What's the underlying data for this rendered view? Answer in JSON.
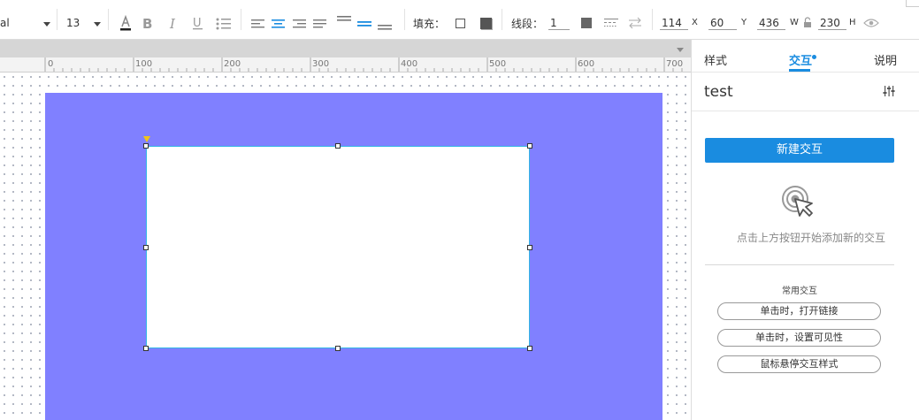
{
  "toolbar": {
    "font_family": "al",
    "font_size": "13",
    "fill_label": "填充：",
    "line_label": "线段：",
    "line_width": "1",
    "x_value": "114",
    "x_label": "X",
    "y_value": "60",
    "y_label": "Y",
    "w_value": "436",
    "w_label": "W",
    "h_value": "230",
    "h_label": "H"
  },
  "ruler": {
    "labels": [
      "0",
      "100",
      "200",
      "300",
      "400",
      "500",
      "600",
      "700"
    ]
  },
  "panel": {
    "tabs": [
      "样式",
      "交互",
      "说明"
    ],
    "active_tab": "交互",
    "widget_name": "test",
    "new_interaction_button": "新建交互",
    "empty_hint": "点击上方按钮开始添加新的交互",
    "common_title": "常用交互",
    "common_actions": [
      "单击时，打开链接",
      "单击时，设置可见性",
      "鼠标悬停交互样式"
    ]
  },
  "colors": {
    "accent": "#1a8ce0",
    "page_background": "#8080ff",
    "selection_border": "#33b5e5"
  }
}
